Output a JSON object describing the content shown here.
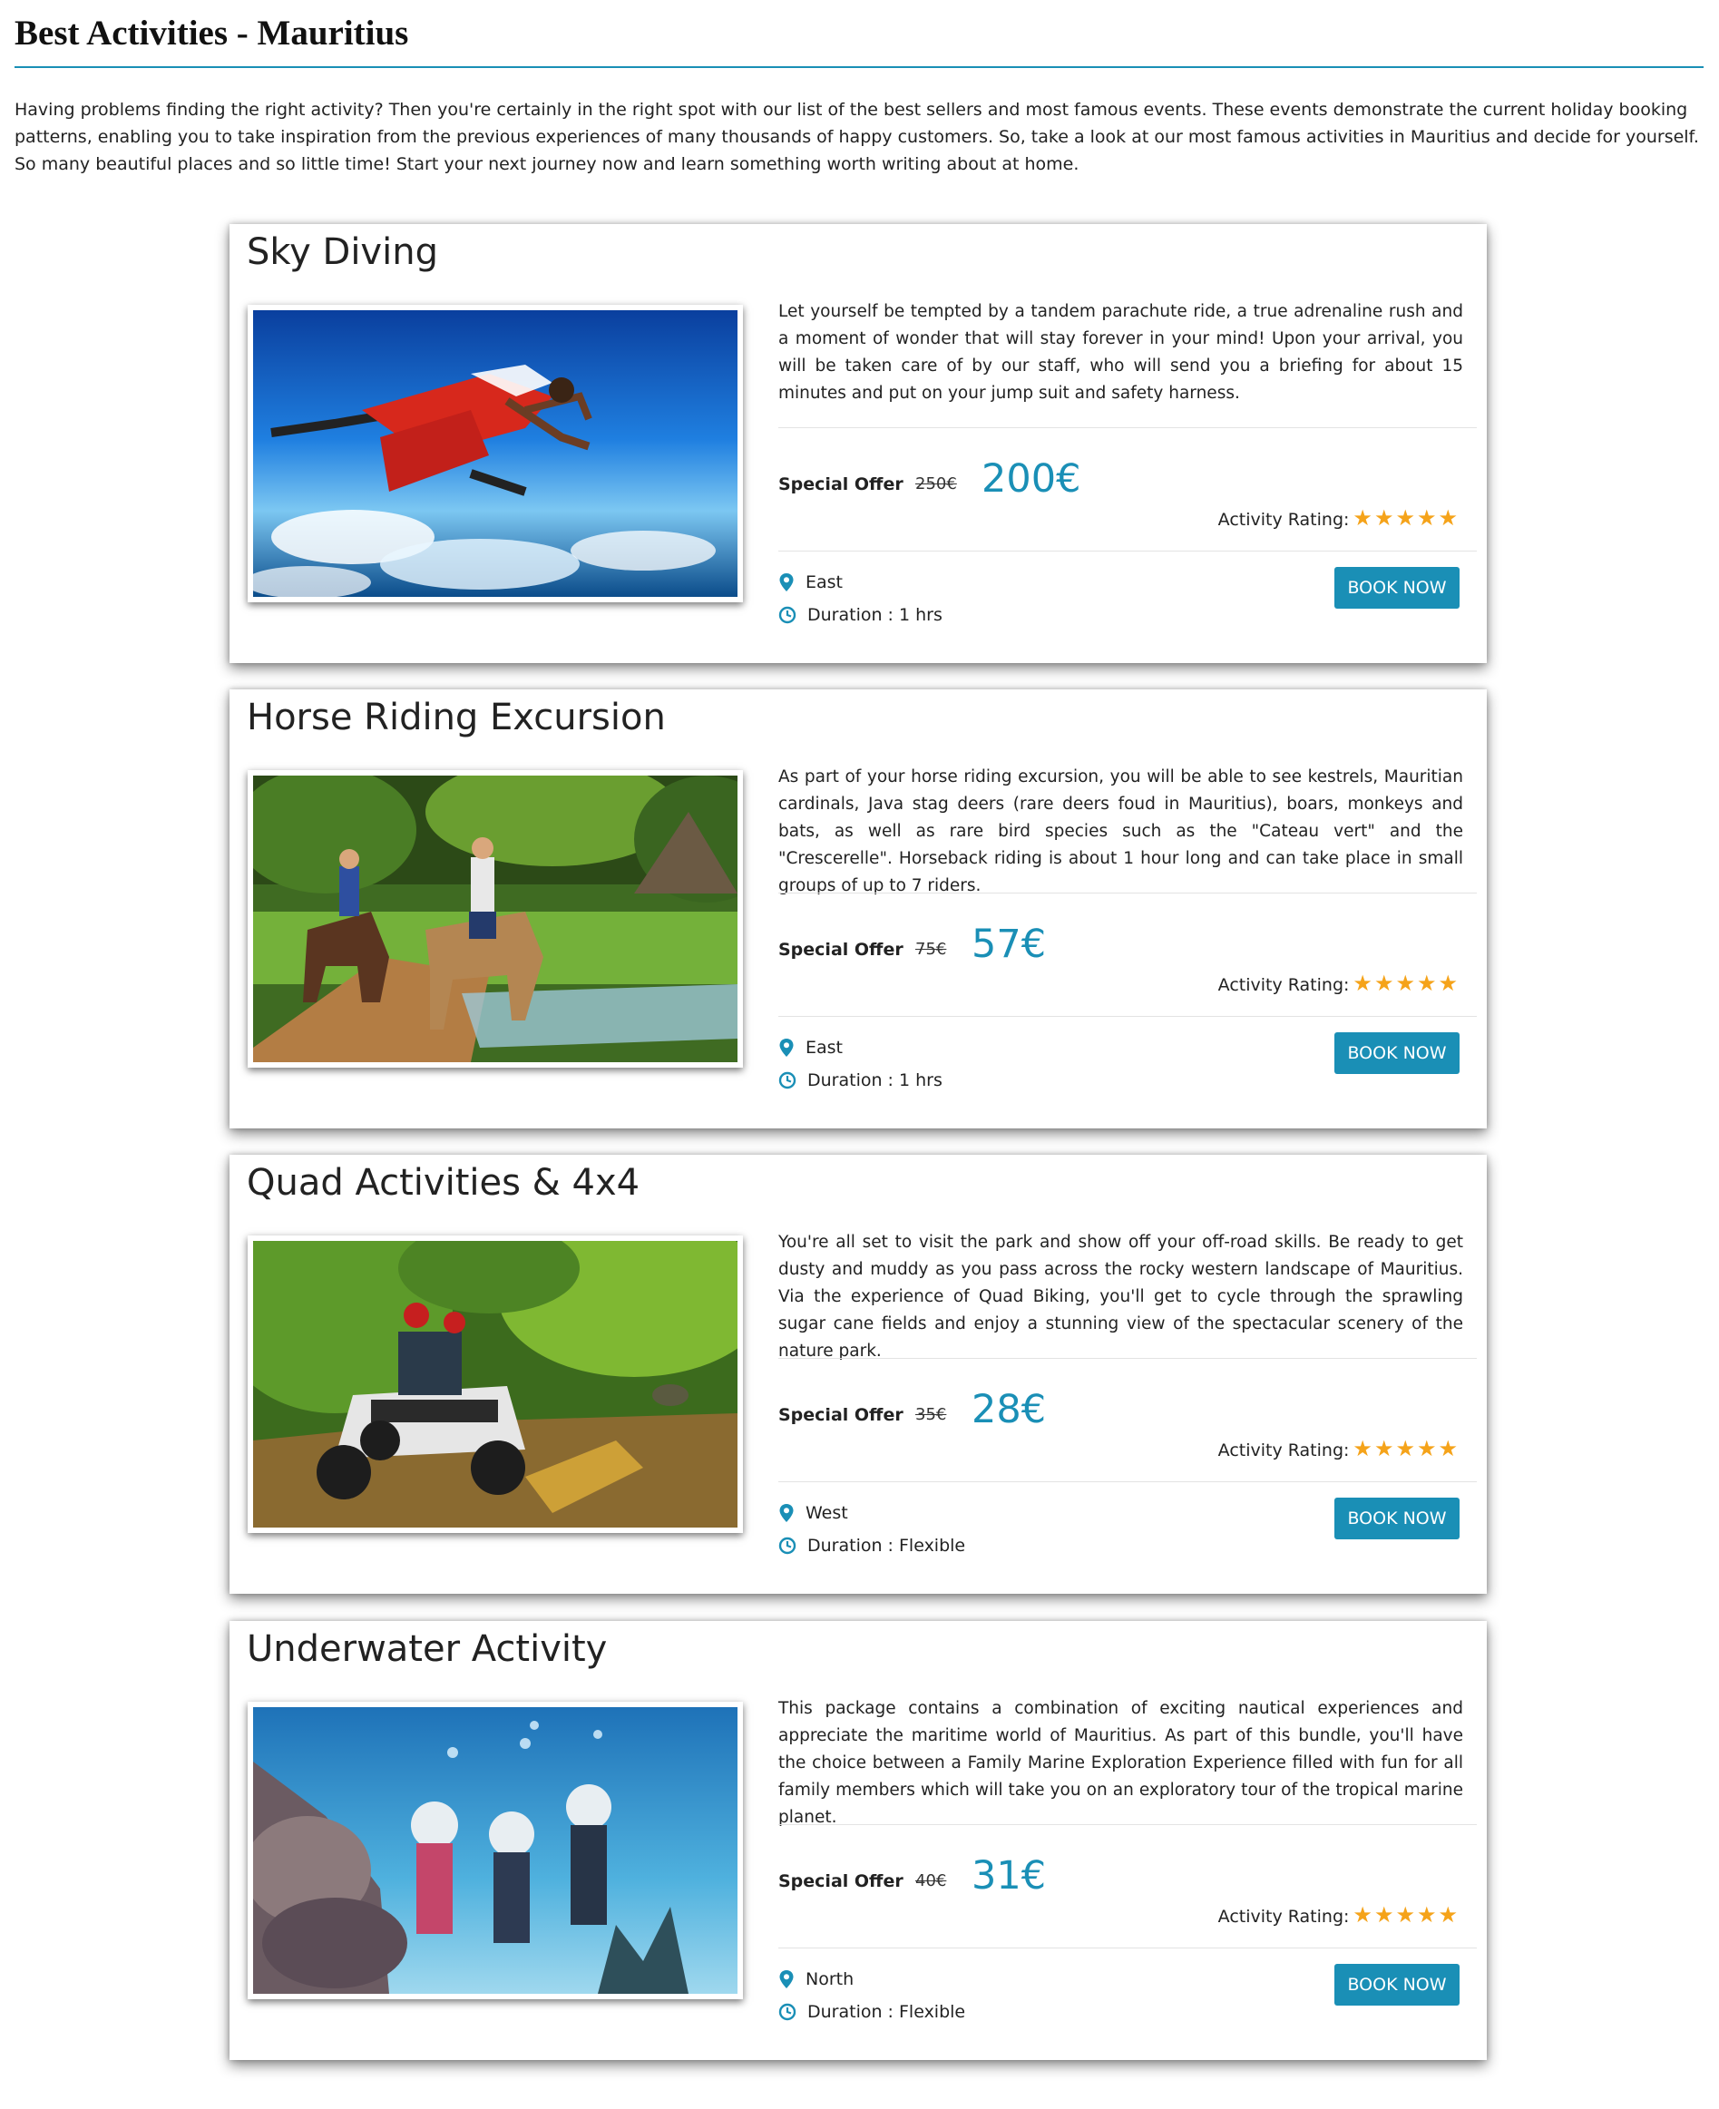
{
  "page": {
    "title": "Best Activities - Mauritius",
    "intro": "Having problems finding the right activity? Then you're certainly in the right spot with our list of the best sellers and most famous events. These events demonstrate the current holiday booking patterns, enabling you to take inspiration from the previous experiences of many thousands of happy customers. So, take a look at our most famous activities in Mauritius and decide for yourself. So many beautiful places and so little time! Start your next journey now and learn something worth writing about at home."
  },
  "labels": {
    "special_offer": "Special Offer",
    "activity_rating": "Activity Rating:",
    "book_now": "BOOK NOW",
    "duration_prefix": "Duration : "
  },
  "colors": {
    "accent": "#1a8fb6",
    "star": "#f5a31a"
  },
  "activities": [
    {
      "title": "Sky Diving",
      "description": "Let yourself be tempted by a tandem parachute ride, a true adrenaline rush and a moment of wonder that will stay forever in your mind! Upon your arrival, you will be taken care of by our staff, who will send you a briefing for about 15 minutes and put on your jump suit and safety harness.",
      "old_price": "250€",
      "new_price": "200€",
      "rating": "★★★★★",
      "location": "East",
      "duration": "Duration : 1 hrs",
      "image": "sky-diving-photo"
    },
    {
      "title": "Horse Riding Excursion",
      "description": "As part of your horse riding excursion, you will be able to see kestrels, Mauritian cardinals, Java stag deers (rare deers foud in Mauritius), boars, monkeys and bats, as well as rare bird species such as the \"Cateau vert\" and the \"Crescerelle\". Horseback riding is about 1 hour long and can take place in small groups of up to 7 riders.",
      "old_price": "75€",
      "new_price": "57€",
      "rating": "★★★★★",
      "location": "East",
      "duration": "Duration : 1 hrs",
      "image": "horse-riding-photo"
    },
    {
      "title": "Quad Activities & 4x4",
      "description": "You're all set to visit the park and show off your off-road skills. Be ready to get dusty and muddy as you pass across the rocky western landscape of Mauritius. Via the experience of Quad Biking, you'll get to cycle through the sprawling sugar cane fields and enjoy a stunning view of the spectacular scenery of the nature park.",
      "old_price": "35€",
      "new_price": "28€",
      "rating": "★★★★★",
      "location": "West",
      "duration": "Duration : Flexible",
      "image": "quad-biking-photo"
    },
    {
      "title": "Underwater Activity",
      "description": "This package contains a combination of exciting nautical experiences and appreciate the maritime world of Mauritius. As part of this bundle, you'll have the choice between a Family Marine Exploration Experience filled with fun for all family members which will take you on an exploratory tour of the tropical marine planet.",
      "old_price": "40€",
      "new_price": "31€",
      "rating": "★★★★★",
      "location": "North",
      "duration": "Duration : Flexible",
      "image": "underwater-walk-photo"
    }
  ]
}
